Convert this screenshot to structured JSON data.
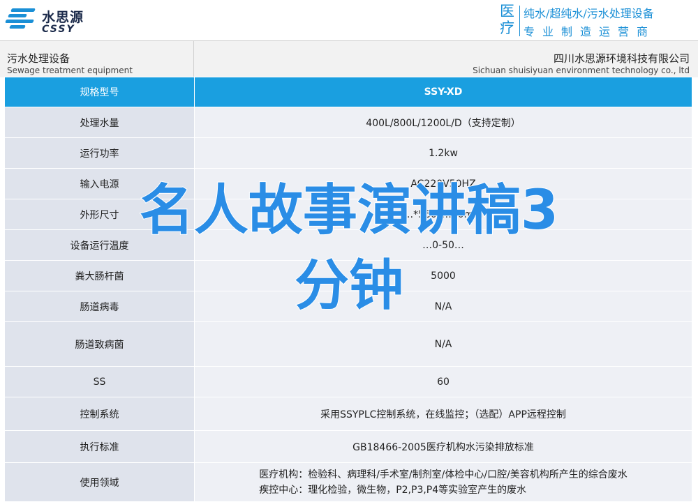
{
  "brand": {
    "name_cn": "水思源",
    "name_en": "CSSY",
    "slogan_char_1": "医",
    "slogan_char_2": "疗",
    "slogan_line_1": "纯水/超纯水/污水处理设备",
    "slogan_line_2": "专业制造运营商",
    "accent_color": "#1a8fd6"
  },
  "title_bar": {
    "product_cn": "污水处理设备",
    "product_en": "Sewage treatment equipment",
    "company_cn": "四川水思源环境科技有限公司",
    "company_en": "Sichuan shuisiyuan environment technology co., ltd"
  },
  "table": {
    "header_color": "#1a9fe0",
    "rows": [
      {
        "label": "规格型号",
        "value": "SSY-XD"
      },
      {
        "label": "处理水量",
        "value": "400L/800L/1200L/D（支持定制）"
      },
      {
        "label": "运行功率",
        "value": "1.2kw"
      },
      {
        "label": "输入电源",
        "value": "AC220V50HZ"
      },
      {
        "label": "外形尺寸",
        "value": "…*560*…40mm"
      },
      {
        "label": "设备运行温度",
        "value": "…0-50…"
      },
      {
        "label": "粪大肠杆菌",
        "value": "5000"
      },
      {
        "label": "肠道病毒",
        "value": "N/A"
      },
      {
        "label": "肠道致病菌",
        "value": "N/A"
      },
      {
        "label": "SS",
        "value": "60"
      },
      {
        "label": "控制系统",
        "value": "采用SSYPLC控制系统，在线监控；（选配）APP远程控制"
      },
      {
        "label": "执行标准",
        "value": "GB18466-2005医疗机构水污染排放标准"
      },
      {
        "label": "使用领域",
        "value_line_1": "医疗机构：检验科、病理科/手术室/制剂室/体检中心/口腔/美容机构所产生的综合废水",
        "value_line_2": "疾控中心：理化检验，微生物，P2,P3,P4等实验室产生的废水"
      }
    ]
  },
  "overlay": {
    "line_1": "名人故事演讲稿3",
    "line_2": "分钟",
    "color": "#2a8de6"
  }
}
